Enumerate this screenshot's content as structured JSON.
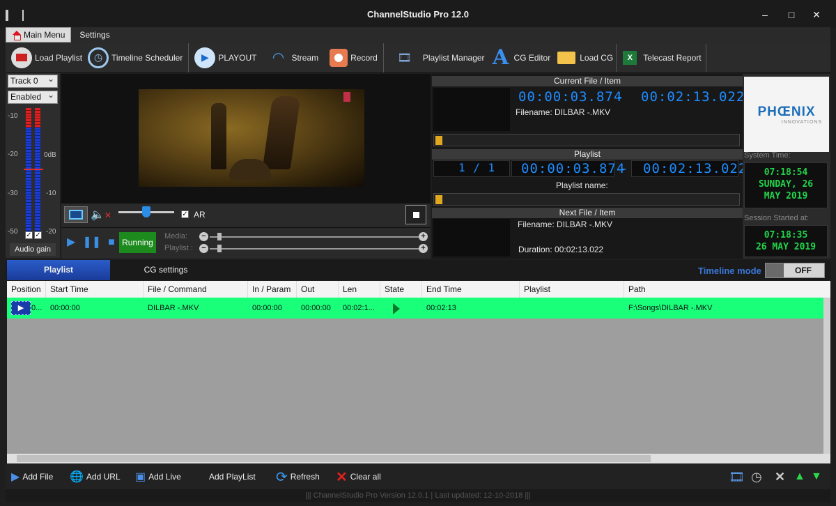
{
  "window": {
    "title": "ChannelStudio   Pro   12.0"
  },
  "menu_tabs": [
    "Main Menu",
    "Settings"
  ],
  "toolbar": {
    "load_playlist": "Load Playlist",
    "timeline_scheduler": "Timeline Scheduler",
    "playout": "PLAYOUT",
    "stream": "Stream",
    "record": "Record",
    "playlist_manager": "Playlist Manager",
    "cg_editor": "CG Editor",
    "load_cg": "Load CG",
    "telecast_report": "Telecast Report"
  },
  "audio": {
    "track": "Track 0",
    "enabled": "Enabled",
    "scale_left": [
      "-10",
      "-20",
      "-30",
      "-50"
    ],
    "scale_right": [
      "0dB",
      "-10",
      "-20"
    ],
    "audio_gain": "Audio gain"
  },
  "preview": {
    "ar_label": "AR",
    "status": "Running",
    "media_label": "Media:",
    "playlist_label": "Playlist :"
  },
  "current": {
    "title": "Current File / Item",
    "elapsed": "00:00:03.874",
    "separator": "-",
    "remaining": "00:02:13.022",
    "filename": "Filename: DILBAR -.MKV"
  },
  "playlist_info": {
    "title": "Playlist",
    "index": "1  /  1",
    "elapsed": "00:00:03.874",
    "separator": "-",
    "remaining": "00:02:13.022",
    "name_label": "Playlist name:"
  },
  "next": {
    "title": "Next File / Item",
    "filename": "Filename: DILBAR -.MKV",
    "duration": "Duration: 00:02:13.022"
  },
  "brand": {
    "logo_text": "PHŒNIX",
    "logo_sub": "INNOVATIONS",
    "system_time_label": "System Time:",
    "system_time": "07:18:54",
    "system_day": "SUNDAY, 26",
    "system_date": "MAY 2019",
    "session_label": "Session Started at:",
    "session_time": "07:18:35",
    "session_date": "26 MAY 2019"
  },
  "playlist_tabs": [
    "Playlist",
    "CG settings"
  ],
  "timeline": {
    "label": "Timeline mode",
    "state": "OFF"
  },
  "table": {
    "columns": [
      "Position",
      "Start Time",
      "File / Command",
      "In / Param",
      "Out",
      "Len",
      "State",
      "End Time",
      "Playlist",
      "Path"
    ],
    "rows": [
      {
        "position": "0...",
        "start": "00:00:00",
        "file": "DILBAR -.MKV",
        "in": "00:00:00",
        "out": "00:00:00",
        "len": "00:02:1...",
        "end": "00:02:13",
        "playlist": "",
        "path": "F:\\Songs\\DILBAR -.MKV"
      }
    ]
  },
  "bottom": {
    "add_file": "Add File",
    "add_url": "Add URL",
    "add_live": "Add Live",
    "add_playlist": "Add PlayList",
    "refresh": "Refresh",
    "clear_all": "Clear all"
  },
  "status": "|||  ChannelStudio Pro Version 12.0.1  |  Last updated: 12-10-2018  |||",
  "colors": {
    "accent_blue": "#1e8cff",
    "row_green": "#19ff7a",
    "clock_green": "#22d44a",
    "running_green": "#1c8a1c"
  }
}
